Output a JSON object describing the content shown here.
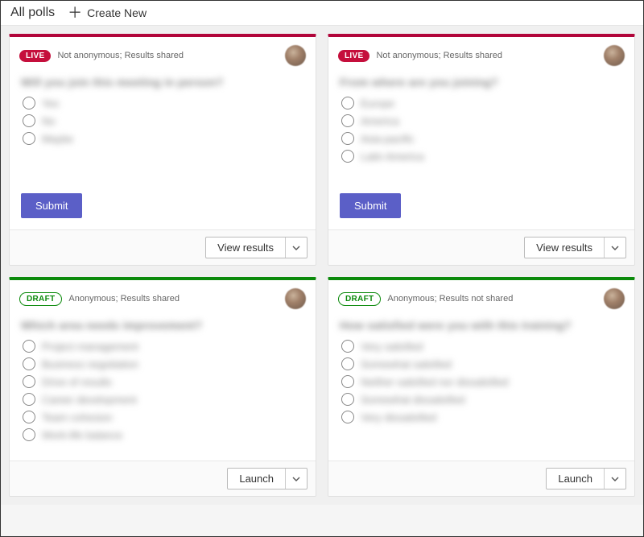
{
  "header": {
    "title": "All polls",
    "create_label": "Create New"
  },
  "badges": {
    "live": "LIVE",
    "draft": "DRAFT"
  },
  "buttons": {
    "submit": "Submit",
    "view_results": "View results",
    "launch": "Launch"
  },
  "polls": [
    {
      "status": "live",
      "meta": "Not anonymous; Results shared",
      "question": "Will you join this meeting in person?",
      "options": [
        "Yes",
        "No",
        "Maybe"
      ]
    },
    {
      "status": "live",
      "meta": "Not anonymous; Results shared",
      "question": "From where are you joining?",
      "options": [
        "Europe",
        "America",
        "Asia-pacific",
        "Latin America"
      ]
    },
    {
      "status": "draft",
      "meta": "Anonymous; Results shared",
      "question": "Which area needs improvement?",
      "options": [
        "Project management",
        "Business negotiation",
        "Drive of results",
        "Career development",
        "Team cohesion",
        "Work-life balance"
      ]
    },
    {
      "status": "draft",
      "meta": "Anonymous; Results not shared",
      "question": "How satisfied were you with this training?",
      "options": [
        "Very satisfied",
        "Somewhat satisfied",
        "Neither satisfied nor dissatisfied",
        "Somewhat dissatisfied",
        "Very dissatisfied"
      ]
    }
  ]
}
